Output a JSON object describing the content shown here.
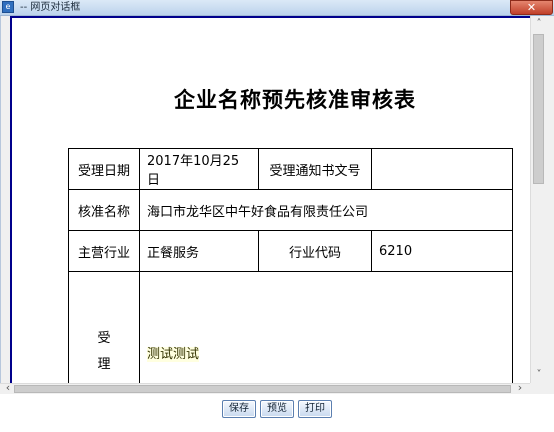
{
  "window": {
    "title": "-- 网页对话框",
    "close_symbol": "✕"
  },
  "document": {
    "title": "企业名称预先核准审核表",
    "rows": {
      "receive_date_label": "受理日期",
      "receive_date_value": "2017年10月25日",
      "notice_no_label": "受理通知书文号",
      "notice_no_value": "",
      "approved_name_label": "核准名称",
      "approved_name_value": "海口市龙华区中午好食品有限责任公司",
      "main_industry_label": "主营行业",
      "main_industry_value": "正餐服务",
      "industry_code_label": "行业代码",
      "industry_code_value": "6210",
      "accept_label_1": "受",
      "accept_label_2": "理",
      "accept_opinion_value": "测试测试"
    }
  },
  "scrollbars": {
    "up_arrow": "˄",
    "down_arrow": "˅",
    "left_arrow": "‹",
    "right_arrow": "›"
  },
  "buttons": {
    "save_label": "保存",
    "preview_label": "预览",
    "print_label": "打印"
  },
  "icons": {
    "window_icon": "ie-page-icon",
    "close_icon": "close-icon"
  },
  "colors": {
    "frame_border": "#00008b",
    "close_button": "#c0402a",
    "button_border": "#5b7fb0"
  }
}
